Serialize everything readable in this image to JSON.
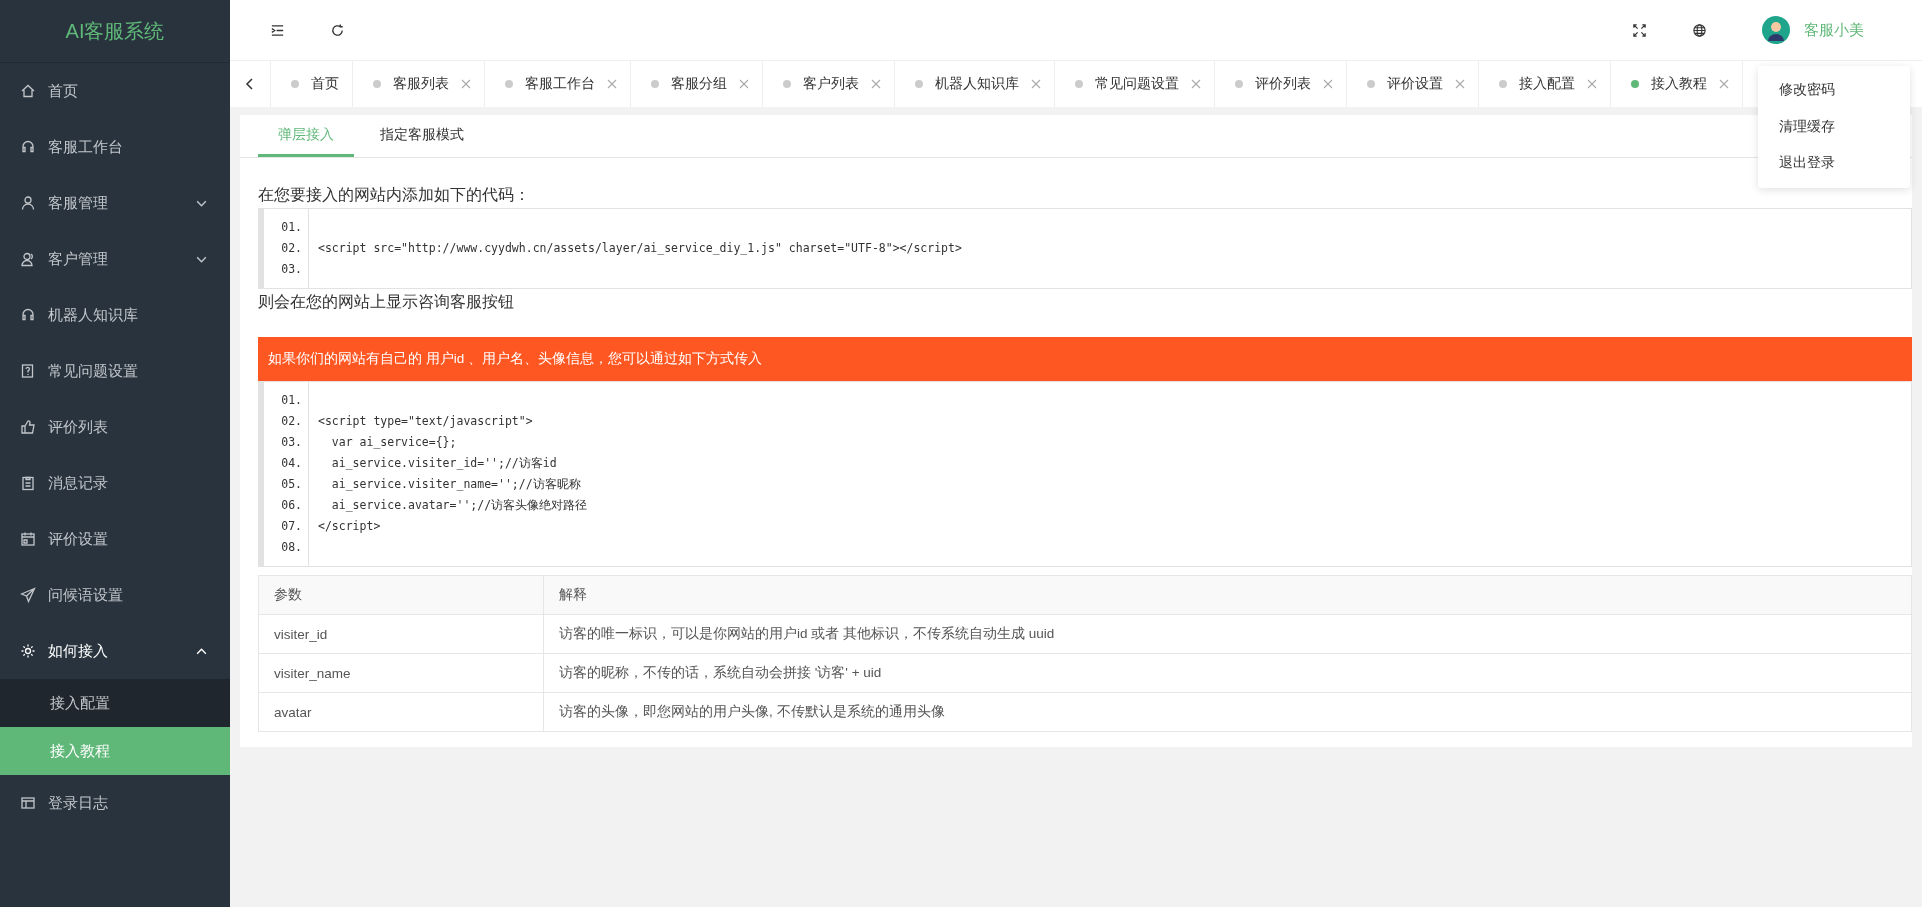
{
  "sidebar": {
    "logo": "AI客服系统",
    "items": [
      {
        "label": "首页",
        "expandable": false,
        "expanded": false,
        "selected": false
      },
      {
        "label": "客服工作台",
        "expandable": false,
        "expanded": false,
        "selected": false
      },
      {
        "label": "客服管理",
        "expandable": true,
        "expanded": false,
        "selected": false
      },
      {
        "label": "客户管理",
        "expandable": true,
        "expanded": false,
        "selected": false
      },
      {
        "label": "机器人知识库",
        "expandable": false,
        "expanded": false,
        "selected": false
      },
      {
        "label": "常见问题设置",
        "expandable": false,
        "expanded": false,
        "selected": false
      },
      {
        "label": "评价列表",
        "expandable": false,
        "expanded": false,
        "selected": false
      },
      {
        "label": "消息记录",
        "expandable": false,
        "expanded": false,
        "selected": false
      },
      {
        "label": "评价设置",
        "expandable": false,
        "expanded": false,
        "selected": false
      },
      {
        "label": "问候语设置",
        "expandable": false,
        "expanded": false,
        "selected": false
      },
      {
        "label": "如何接入",
        "expandable": true,
        "expanded": true,
        "selected": false,
        "children": [
          {
            "label": "接入配置",
            "selected": false
          },
          {
            "label": "接入教程",
            "selected": true
          }
        ]
      },
      {
        "label": "登录日志",
        "expandable": false,
        "expanded": false,
        "selected": false
      }
    ]
  },
  "header": {
    "user_name": "客服小美"
  },
  "user_menu": [
    "修改密码",
    "清理缓存",
    "退出登录"
  ],
  "tabs": [
    {
      "label": "首页",
      "closable": false,
      "selected": false
    },
    {
      "label": "客服列表",
      "closable": true,
      "selected": false
    },
    {
      "label": "客服工作台",
      "closable": true,
      "selected": false
    },
    {
      "label": "客服分组",
      "closable": true,
      "selected": false
    },
    {
      "label": "客户列表",
      "closable": true,
      "selected": false
    },
    {
      "label": "机器人知识库",
      "closable": true,
      "selected": false
    },
    {
      "label": "常见问题设置",
      "closable": true,
      "selected": false
    },
    {
      "label": "评价列表",
      "closable": true,
      "selected": false
    },
    {
      "label": "评价设置",
      "closable": true,
      "selected": false
    },
    {
      "label": "接入配置",
      "closable": true,
      "selected": false
    },
    {
      "label": "接入教程",
      "closable": true,
      "selected": true
    }
  ],
  "content": {
    "subtabs": [
      {
        "label": "弹层接入",
        "selected": true
      },
      {
        "label": "指定客服模式",
        "selected": false
      }
    ],
    "intro": "在您要接入的网站内添加如下的代码：",
    "code_1": [
      {
        "number": "01."
      },
      {
        "number": "02.",
        "code": "<script src=\"http://www.cyydwh.cn/assets/layer/ai_service_diy_1.js\" charset=\"UTF-8\"></script>"
      },
      {
        "number": "03."
      }
    ],
    "result": "则会在您的网站上显示咨询客服按钮",
    "notice": "如果你们的网站有自己的 用户id 、用户名、头像信息，您可以通过如下方式传入",
    "code_2": [
      {
        "number": "01."
      },
      {
        "number": "02.",
        "code": "<script type=\"text/javascript\">"
      },
      {
        "number": "03.",
        "code": "  var ai_service={};"
      },
      {
        "number": "04.",
        "code": "  ai_service.visiter_id='';//访客id"
      },
      {
        "number": "05.",
        "code": "  ai_service.visiter_name='';//访客昵称"
      },
      {
        "number": "06.",
        "code": "  ai_service.avatar='';//访客头像绝对路径"
      },
      {
        "number": "07.",
        "code": "</script>"
      },
      {
        "number": "08."
      }
    ],
    "table": {
      "columns": [
        "参数",
        "解释"
      ],
      "rows": [
        [
          "visiter_id",
          "访客的唯一标识，可以是你网站的用户id 或者 其他标识，不传系统自动生成 uuid"
        ],
        [
          "visiter_name",
          "访客的昵称，不传的话，系统自动会拼接 '访客' + uid"
        ],
        [
          "avatar",
          "访客的头像，即您网站的用户头像, 不传默认是系统的通用头像"
        ]
      ]
    }
  }
}
